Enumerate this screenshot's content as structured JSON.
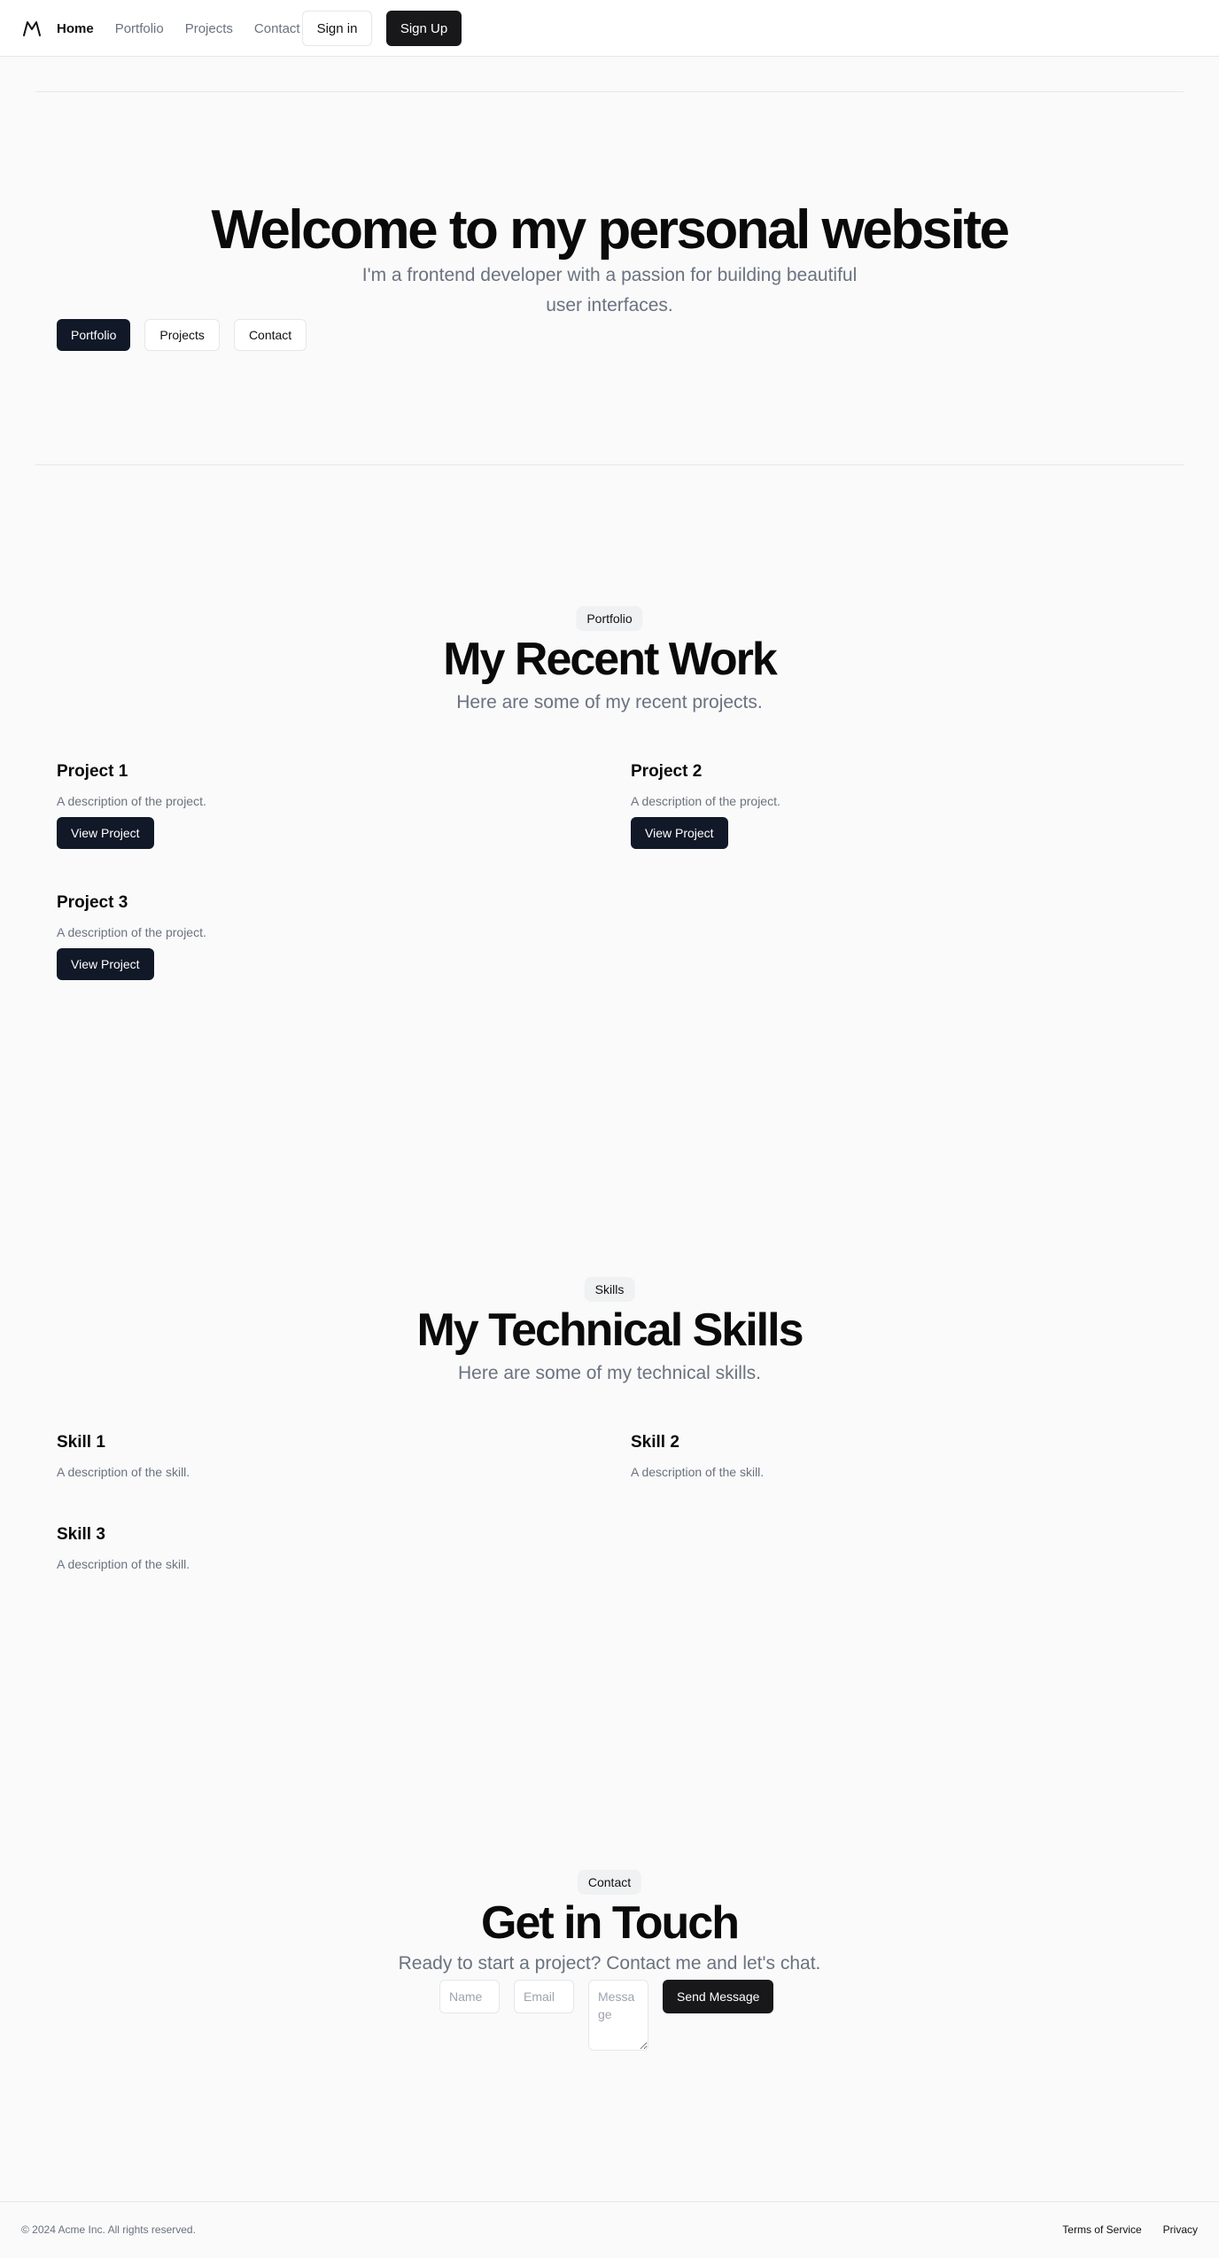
{
  "header": {
    "nav": [
      "Home",
      "Portfolio",
      "Projects",
      "Contact"
    ],
    "signin_label": "Sign in",
    "signup_label": "Sign Up"
  },
  "hero": {
    "title": "Welcome to my personal website",
    "subtitle": "I'm a frontend developer with a passion for building beautiful user interfaces.",
    "buttons": [
      "Portfolio",
      "Projects",
      "Contact"
    ]
  },
  "portfolio": {
    "badge": "Portfolio",
    "title": "My Recent Work",
    "subtitle": "Here are some of my recent projects.",
    "projects": [
      {
        "title": "Project 1",
        "description": "A description of the project.",
        "button": "View Project"
      },
      {
        "title": "Project 2",
        "description": "A description of the project.",
        "button": "View Project"
      },
      {
        "title": "Project 3",
        "description": "A description of the project.",
        "button": "View Project"
      }
    ]
  },
  "skills": {
    "badge": "Skills",
    "title": "My Technical Skills",
    "subtitle": "Here are some of my technical skills.",
    "items": [
      {
        "title": "Skill 1",
        "description": "A description of the skill."
      },
      {
        "title": "Skill 2",
        "description": "A description of the skill."
      },
      {
        "title": "Skill 3",
        "description": "A description of the skill."
      }
    ]
  },
  "contact": {
    "badge": "Contact",
    "title": "Get in Touch",
    "subtitle": "Ready to start a project? Contact me and let's chat.",
    "name_placeholder": "Name",
    "email_placeholder": "Email",
    "message_placeholder": "Message",
    "send_label": "Send Message"
  },
  "footer": {
    "copyright": "© 2024 Acme Inc. All rights reserved.",
    "links": [
      "Terms of Service",
      "Privacy"
    ]
  }
}
